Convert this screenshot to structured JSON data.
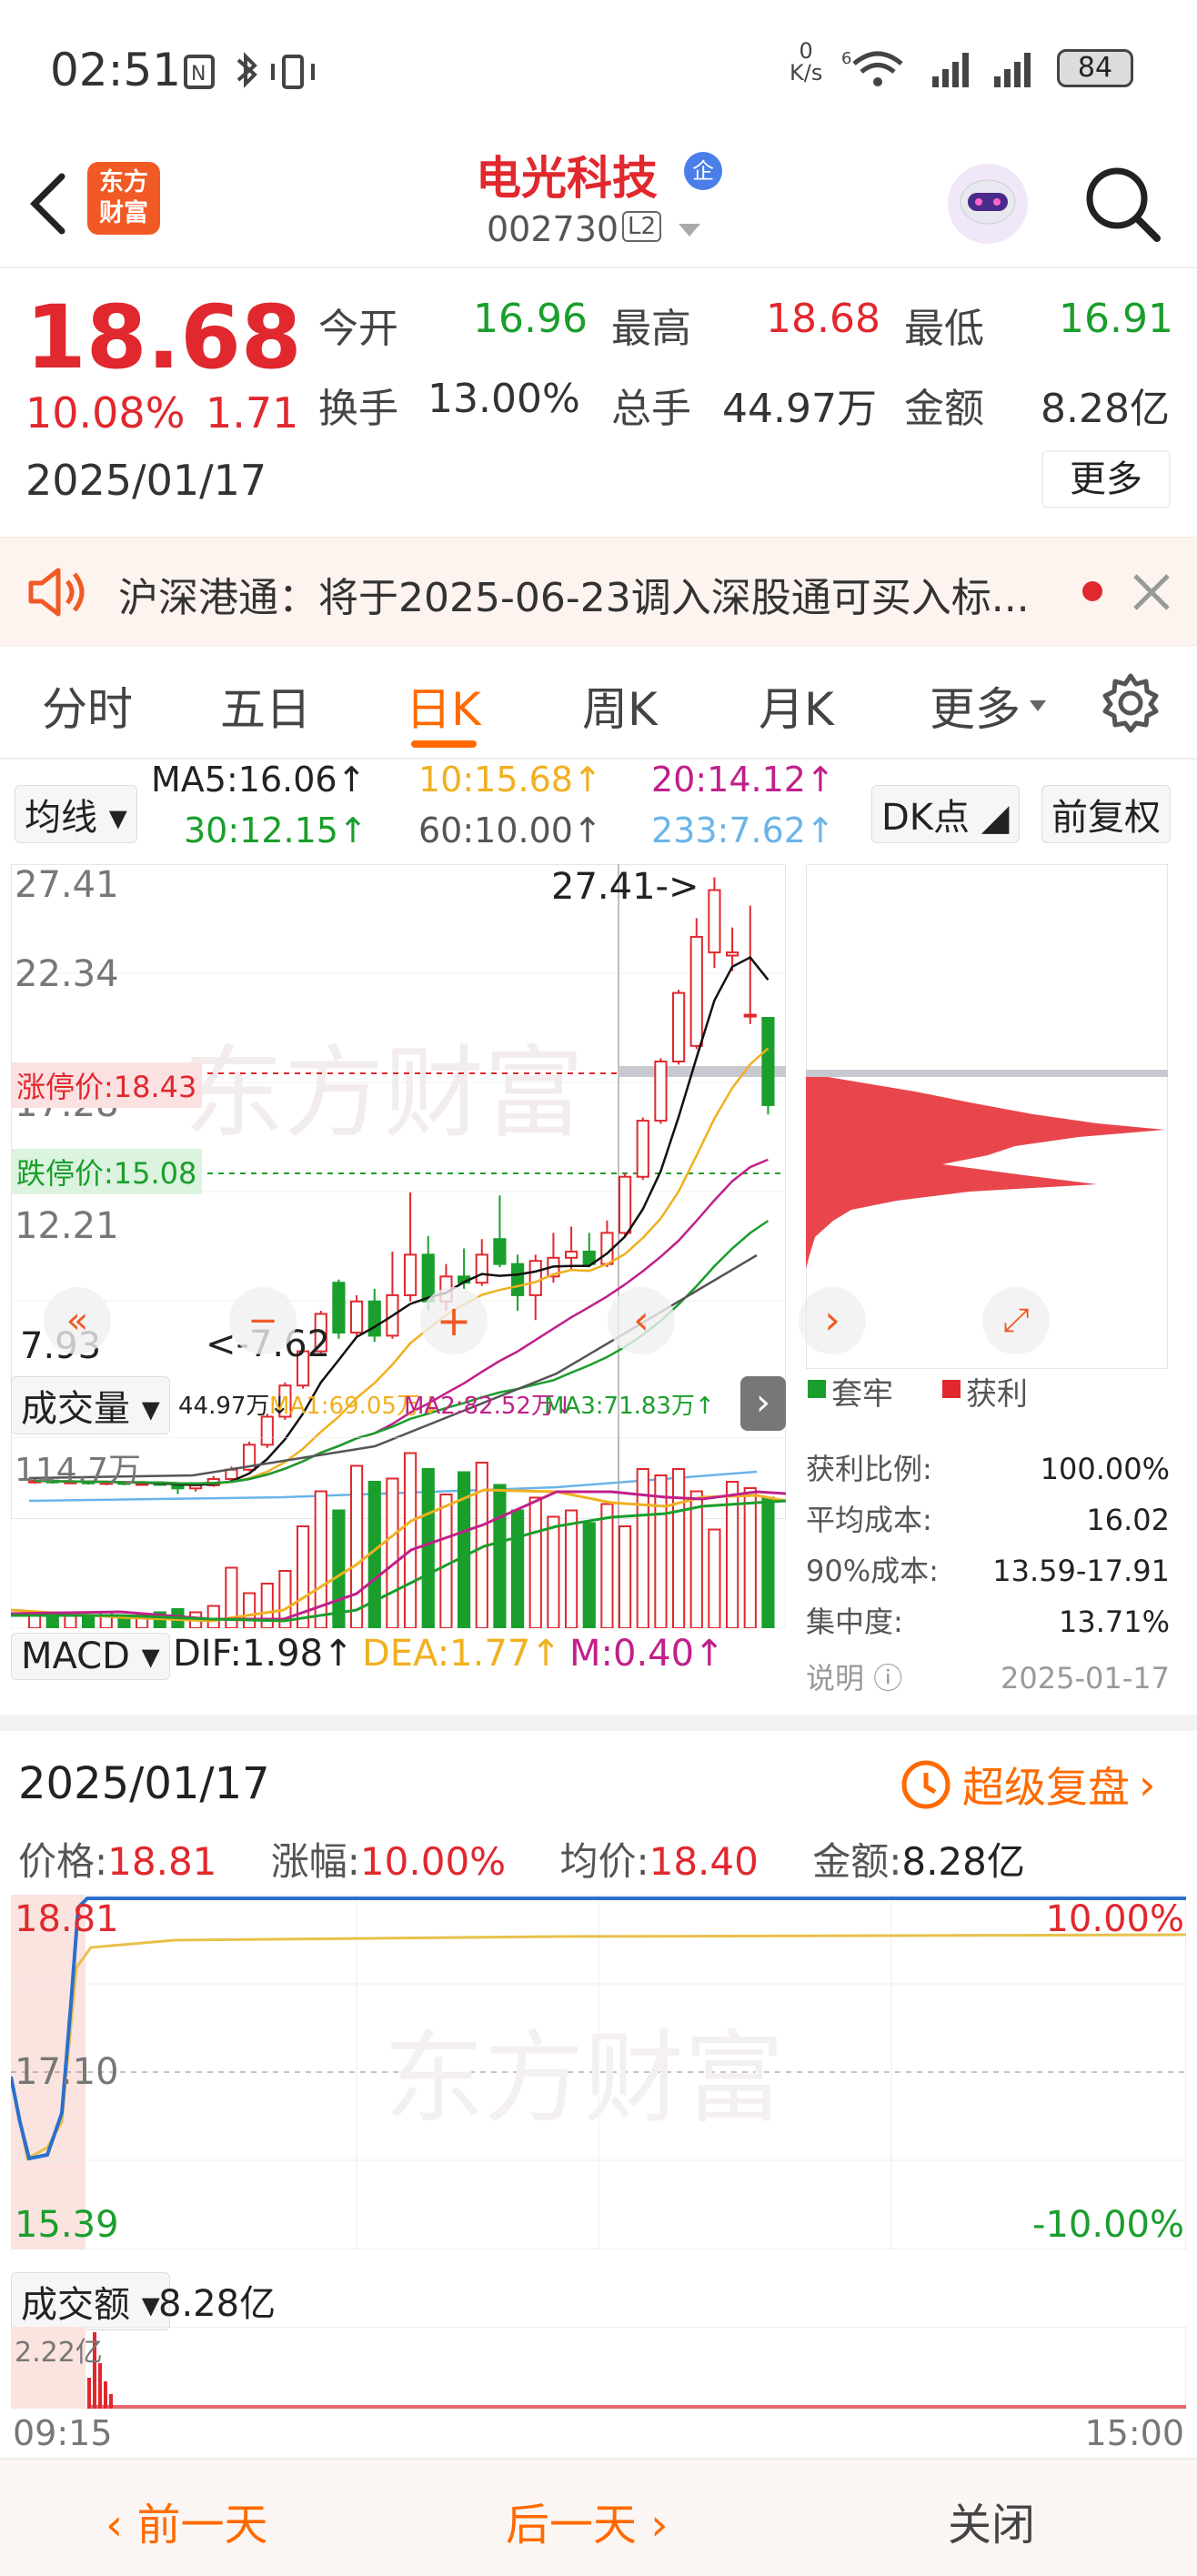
{
  "status_bar": {
    "time": "02:51",
    "net_speed_top": "0",
    "net_speed_unit": "K/s",
    "signal_label": "6",
    "battery": "84"
  },
  "header": {
    "back_icon": "chevron-left-icon",
    "brand_logo_text_1": "东方",
    "brand_logo_text_2": "财富",
    "stock_name": "电光科技",
    "enterprise_badge": "企",
    "stock_code": "002730",
    "level_badge": "L2",
    "avatar_icon": "robot-avatar-icon",
    "search_icon": "search-icon"
  },
  "quote": {
    "price": "18.68",
    "change_pct": "10.08%",
    "change_amt": "1.71",
    "date": "2025/01/17",
    "fields": [
      {
        "label": "今开",
        "value": "16.96",
        "color": "green"
      },
      {
        "label": "最高",
        "value": "18.68",
        "color": "red"
      },
      {
        "label": "最低",
        "value": "16.91",
        "color": "green"
      },
      {
        "label": "换手",
        "value": "13.00%",
        "color": "dark"
      },
      {
        "label": "总手",
        "value": "44.97万",
        "color": "dark"
      },
      {
        "label": "金额",
        "value": "8.28亿",
        "color": "dark"
      }
    ],
    "more_button": "更多"
  },
  "notice": {
    "icon": "speaker-icon",
    "text": "沪深港通：将于2025-06-23调入深股通可买入标...",
    "close_icon": "close-icon"
  },
  "tabs": {
    "items": [
      "分时",
      "五日",
      "日K",
      "周K",
      "月K",
      "更多"
    ],
    "active": "日K",
    "settings_icon": "gear-icon"
  },
  "ma_legend": {
    "selector": "均线",
    "ma5": "MA5:16.06↑",
    "ma10": "10:15.68↑",
    "ma20": "20:14.12↑",
    "ma30": "30:12.15↑",
    "ma60": "60:10.00↑",
    "ma233": "233:7.62↑",
    "dk_button": "DK点",
    "fq_button": "前复权"
  },
  "kline": {
    "y_labels": [
      "27.41",
      "22.34",
      "17.28",
      "12.21",
      "7.93"
    ],
    "high_marker": "27.41->",
    "low_marker": "<-7.62",
    "limit_up": "涨停价:18.43",
    "limit_down": "跌停价:15.08",
    "watermark": "东方财富"
  },
  "volume": {
    "selector": "成交量",
    "val": "44.97万↓",
    "ma1": "MA1:69.05万↓",
    "ma2": "MA2:82.52万↓",
    "ma3": "MA3:71.83万↑",
    "y_max": "114.7万"
  },
  "macd": {
    "selector": "MACD",
    "dif": "DIF:1.98↑",
    "dea": "DEA:1.77↑",
    "m": "M:0.40↑"
  },
  "chip": {
    "legend_trapped": "套牢",
    "legend_profit": "获利",
    "rows": [
      {
        "label": "获利比例:",
        "value": "100.00%"
      },
      {
        "label": "平均成本:",
        "value": "16.02"
      },
      {
        "label": "90%成本:",
        "value": "13.59-17.91"
      },
      {
        "label": "集中度:",
        "value": "13.71%"
      }
    ],
    "note_label": "说明",
    "note_date": "2025-01-17"
  },
  "panel": {
    "date": "2025/01/17",
    "replay_button": "超级复盘",
    "price_label": "价格:",
    "price": "18.81",
    "chg_label": "涨幅:",
    "chg": "10.00%",
    "avg_label": "均价:",
    "avg": "18.40",
    "amt_label": "金额:",
    "amt": "8.28亿",
    "y_top": "18.81",
    "y_mid": "17.10",
    "y_bot": "15.39",
    "pct_top": "10.00%",
    "pct_bot": "-10.00%",
    "watermark": "东方财富",
    "turnover_selector": "成交额",
    "turnover_val": "8.28亿",
    "turnover_max": "2.22亿",
    "t_start": "09:15",
    "t_end": "15:00"
  },
  "bottom_nav": {
    "prev": "前一天",
    "next": "后一天",
    "close": "关闭"
  },
  "colors": {
    "red": "#e0282e",
    "green": "#1a9e2c",
    "accent": "#ff6a00"
  },
  "chart_data": {
    "type": "candlestick",
    "candles": [
      {
        "o": 8.0,
        "c": 8.05,
        "h": 8.1,
        "l": 7.95
      },
      {
        "o": 8.05,
        "c": 8.0,
        "h": 8.1,
        "l": 7.95
      },
      {
        "o": 8.0,
        "c": 8.02,
        "h": 8.08,
        "l": 7.96
      },
      {
        "o": 8.02,
        "c": 7.98,
        "h": 8.05,
        "l": 7.92
      },
      {
        "o": 7.98,
        "c": 8.0,
        "h": 8.04,
        "l": 7.9
      },
      {
        "o": 8.0,
        "c": 7.95,
        "h": 8.02,
        "l": 7.9
      },
      {
        "o": 7.95,
        "c": 7.97,
        "h": 8.0,
        "l": 7.9
      },
      {
        "o": 7.97,
        "c": 7.93,
        "h": 8.0,
        "l": 7.88
      },
      {
        "o": 7.93,
        "c": 7.8,
        "h": 7.96,
        "l": 7.62
      },
      {
        "o": 7.8,
        "c": 7.9,
        "h": 7.98,
        "l": 7.7
      },
      {
        "o": 7.9,
        "c": 8.1,
        "h": 8.2,
        "l": 7.85
      },
      {
        "o": 8.1,
        "c": 8.4,
        "h": 8.5,
        "l": 8.0
      },
      {
        "o": 8.4,
        "c": 9.2,
        "h": 9.3,
        "l": 8.35
      },
      {
        "o": 9.2,
        "c": 10.1,
        "h": 10.2,
        "l": 9.1
      },
      {
        "o": 10.1,
        "c": 11.1,
        "h": 11.2,
        "l": 10.0
      },
      {
        "o": 11.1,
        "c": 12.2,
        "h": 12.3,
        "l": 11.0
      },
      {
        "o": 12.2,
        "c": 13.4,
        "h": 13.5,
        "l": 12.1
      },
      {
        "o": 14.4,
        "c": 12.8,
        "h": 14.5,
        "l": 12.6
      },
      {
        "o": 12.8,
        "c": 13.8,
        "h": 14.0,
        "l": 12.7
      },
      {
        "o": 13.8,
        "c": 12.7,
        "h": 14.2,
        "l": 12.5
      },
      {
        "o": 12.7,
        "c": 14.0,
        "h": 15.4,
        "l": 12.6
      },
      {
        "o": 14.0,
        "c": 15.3,
        "h": 17.3,
        "l": 13.8
      },
      {
        "o": 15.3,
        "c": 13.8,
        "h": 15.9,
        "l": 13.5
      },
      {
        "o": 13.8,
        "c": 14.6,
        "h": 15.0,
        "l": 13.5
      },
      {
        "o": 14.6,
        "c": 14.4,
        "h": 15.5,
        "l": 14.2
      },
      {
        "o": 14.4,
        "c": 15.3,
        "h": 15.8,
        "l": 14.3
      },
      {
        "o": 15.8,
        "c": 15.0,
        "h": 17.2,
        "l": 14.9
      },
      {
        "o": 15.0,
        "c": 14.0,
        "h": 15.3,
        "l": 13.5
      },
      {
        "o": 14.0,
        "c": 15.1,
        "h": 15.3,
        "l": 13.2
      },
      {
        "o": 14.6,
        "c": 15.2,
        "h": 16.0,
        "l": 14.4
      },
      {
        "o": 15.2,
        "c": 15.4,
        "h": 16.2,
        "l": 14.8
      },
      {
        "o": 15.4,
        "c": 15.0,
        "h": 16.0,
        "l": 14.9
      },
      {
        "o": 15.0,
        "c": 16.0,
        "h": 16.4,
        "l": 14.9
      },
      {
        "o": 16.0,
        "c": 17.8,
        "h": 17.9,
        "l": 15.9
      },
      {
        "o": 17.8,
        "c": 19.6,
        "h": 19.7,
        "l": 17.7
      },
      {
        "o": 19.6,
        "c": 21.5,
        "h": 21.6,
        "l": 19.5
      },
      {
        "o": 21.5,
        "c": 23.7,
        "h": 23.8,
        "l": 21.4
      },
      {
        "o": 22.0,
        "c": 25.5,
        "h": 26.1,
        "l": 21.9
      },
      {
        "o": 25.0,
        "c": 27.0,
        "h": 27.41,
        "l": 24.5
      },
      {
        "o": 24.9,
        "c": 25.0,
        "h": 25.8,
        "l": 24.4
      },
      {
        "o": 23.0,
        "c": 23.0,
        "h": 26.5,
        "l": 22.7
      },
      {
        "o": 22.9,
        "c": 20.1,
        "h": 22.8,
        "l": 19.8
      }
    ]
  }
}
